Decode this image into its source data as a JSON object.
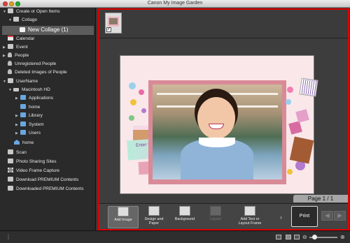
{
  "window": {
    "title": "Canon My Image Garden"
  },
  "sidebar": {
    "items": [
      {
        "label": "Create or Open Items"
      },
      {
        "label": "Collage"
      },
      {
        "label": "New Collage (1)"
      },
      {
        "label": "Calendar"
      },
      {
        "label": "Event"
      },
      {
        "label": "People"
      },
      {
        "label": "Unregistered People"
      },
      {
        "label": "Deleted Images of People"
      },
      {
        "label": "UserName"
      },
      {
        "label": "Macintosh HD"
      },
      {
        "label": "Applications"
      },
      {
        "label": "home"
      },
      {
        "label": "Library"
      },
      {
        "label": "System"
      },
      {
        "label": "Users"
      },
      {
        "label": "home"
      },
      {
        "label": "Scan"
      },
      {
        "label": "Photo Sharing Sites"
      },
      {
        "label": "Video Frame Capture"
      },
      {
        "label": "Download PREMIUM Contents"
      },
      {
        "label": "Downloaded PREMIUM Contents"
      }
    ]
  },
  "thumbnail": {
    "checked_glyph": "✓"
  },
  "canvas": {
    "enter_text": "Enter text."
  },
  "pager": {
    "label": "Page 1 / 1"
  },
  "toolbar": {
    "add_image": "Add Image",
    "design_line1": "Design and",
    "design_line2": "Paper",
    "background": "Background",
    "layout": "Layout",
    "add_text_line1": "Add Text or",
    "add_text_line2": "Layout Frame",
    "print": "Print",
    "chevron": "›",
    "prev": "◀",
    "next": "▶"
  },
  "statusbar": {
    "info_glyph": "⋮",
    "zoom_out": "⊖",
    "zoom_in": "⊕"
  },
  "colors": {
    "highlight_border": "#e00000",
    "sidebar_bg": "#2a2a2a",
    "page_bg": "#f9e7e9",
    "frame": "#d98a97"
  }
}
